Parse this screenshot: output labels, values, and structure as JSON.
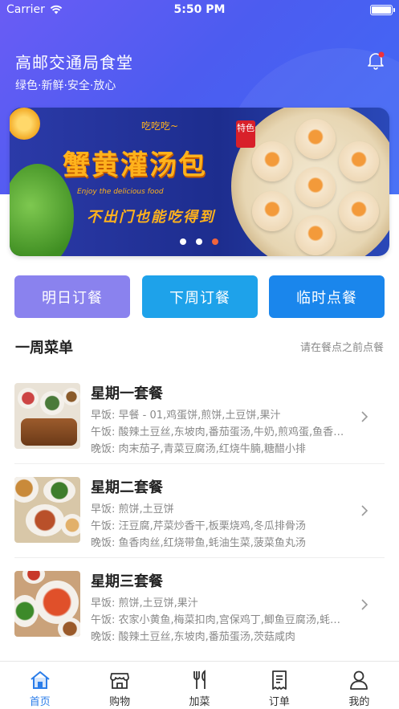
{
  "status_bar": {
    "carrier": "Carrier",
    "time": "5:50 PM"
  },
  "header": {
    "title": "高邮交通局食堂",
    "subtitle": "绿色·新鲜·安全·放心"
  },
  "banner": {
    "tag": "特色",
    "small_text": "吃吃吃~",
    "title": "蟹黄灌汤包",
    "english": "Enjoy the delicious food",
    "slogan": "不出门也能吃得到",
    "page_count": 3,
    "active_page": 3
  },
  "order_buttons": {
    "tomorrow": "明日订餐",
    "next_week": "下周订餐",
    "temporary": "临时点餐"
  },
  "colors": {
    "tomorrow": "#8a82ee",
    "next_week": "#1ea2ea",
    "temporary": "#1a86ec",
    "accent": "#2b7de9"
  },
  "weekly_menu": {
    "title": "一周菜单",
    "hint": "请在餐点之前点餐",
    "items": [
      {
        "title": "星期一套餐",
        "breakfast": "早饭: 早餐 - 01,鸡蛋饼,煎饼,土豆饼,果汁",
        "lunch": "午饭: 酸辣土豆丝,东坡肉,番茄蛋汤,牛奶,煎鸡蛋,鱼香肉丝",
        "dinner": "晚饭: 肉末茄子,青菜豆腐汤,红烧牛腩,糖醋小排"
      },
      {
        "title": "星期二套餐",
        "breakfast": "早饭: 煎饼,土豆饼",
        "lunch": "午饭: 汪豆腐,芹菜炒香干,板栗烧鸡,冬瓜排骨汤",
        "dinner": "晚饭: 鱼香肉丝,红烧带鱼,蚝油生菜,菠菜鱼丸汤"
      },
      {
        "title": "星期三套餐",
        "breakfast": "早饭: 煎饼,土豆饼,果汁",
        "lunch": "午饭: 农家小黄鱼,梅菜扣肉,宫保鸡丁,鲫鱼豆腐汤,蚝油生菜",
        "dinner": "晚饭: 酸辣土豆丝,东坡肉,番茄蛋汤,茨菇咸肉"
      }
    ]
  },
  "tabbar": {
    "tabs": [
      {
        "label": "首页",
        "icon": "home-icon",
        "active": true
      },
      {
        "label": "购物",
        "icon": "shop-icon",
        "active": false
      },
      {
        "label": "加菜",
        "icon": "fork-knife-icon",
        "active": false
      },
      {
        "label": "订单",
        "icon": "order-icon",
        "active": false
      },
      {
        "label": "我的",
        "icon": "user-icon",
        "active": false
      }
    ]
  }
}
